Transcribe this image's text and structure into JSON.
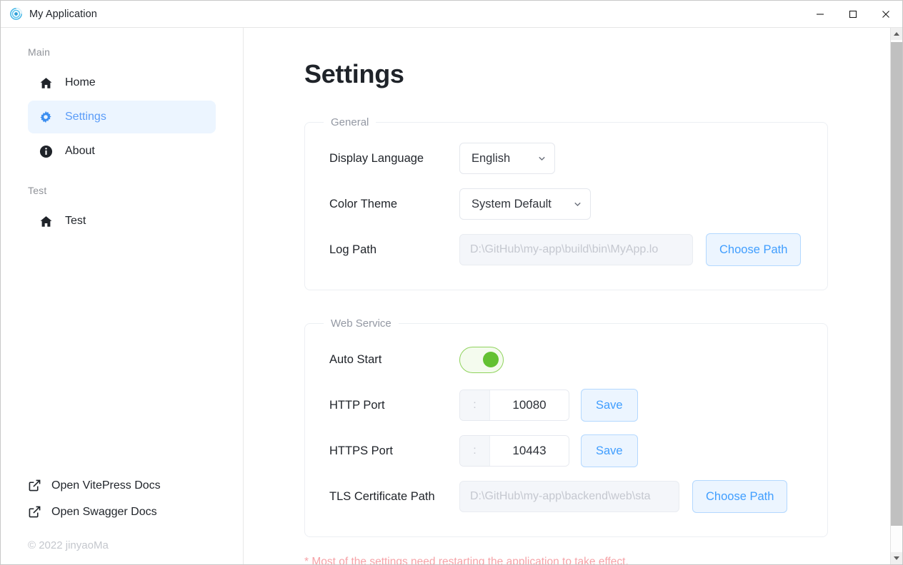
{
  "window": {
    "title": "My Application",
    "logo_icon": "spiral-logo-icon",
    "controls": {
      "minimize": "minimize-icon",
      "maximize": "maximize-icon",
      "close": "close-icon"
    }
  },
  "sidebar": {
    "groups": [
      {
        "label": "Main",
        "items": [
          {
            "label": "Home",
            "icon": "home-icon",
            "active": false
          },
          {
            "label": "Settings",
            "icon": "gear-icon",
            "active": true
          },
          {
            "label": "About",
            "icon": "info-circle-icon",
            "active": false
          }
        ]
      },
      {
        "label": "Test",
        "items": [
          {
            "label": "Test",
            "icon": "home-icon",
            "active": false
          }
        ]
      }
    ],
    "footer_links": [
      {
        "label": "Open VitePress Docs",
        "icon": "external-link-icon"
      },
      {
        "label": "Open Swagger Docs",
        "icon": "external-link-icon"
      }
    ],
    "copyright": "© 2022 jinyaoMa"
  },
  "main": {
    "page_title": "Settings",
    "sections": [
      {
        "legend": "General",
        "rows": [
          {
            "label": "Display Language",
            "control": "select",
            "value": "English",
            "options": [
              "English"
            ]
          },
          {
            "label": "Color Theme",
            "control": "select",
            "value": "System Default",
            "options": [
              "System Default"
            ]
          },
          {
            "label": "Log Path",
            "control": "path",
            "value": "",
            "placeholder": "D:\\GitHub\\my-app\\build\\bin\\MyApp.lo",
            "button": "Choose Path"
          }
        ]
      },
      {
        "legend": "Web Service",
        "rows": [
          {
            "label": "Auto Start",
            "control": "toggle",
            "checked": true
          },
          {
            "label": "HTTP Port",
            "control": "port",
            "prefix": ":",
            "value": "10080",
            "button": "Save"
          },
          {
            "label": "HTTPS Port",
            "control": "port",
            "prefix": ":",
            "value": "10443",
            "button": "Save"
          },
          {
            "label": "TLS Certificate Path",
            "control": "path",
            "value": "",
            "placeholder": "D:\\GitHub\\my-app\\backend\\web\\sta",
            "button": "Choose Path"
          }
        ]
      }
    ],
    "note": "* Most of the settings need restarting the application to take effect."
  },
  "colors": {
    "accent_blue": "#409eff",
    "accent_blue_soft": "#ecf5ff",
    "toggle_green": "#63c132",
    "note_red": "#f6a3a8",
    "text_dark": "#1f2329",
    "text_muted": "#909399"
  }
}
